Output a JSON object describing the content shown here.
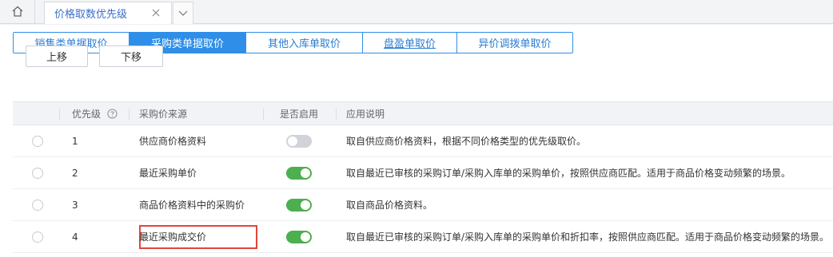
{
  "window": {
    "tab_title": "价格取数优先级",
    "icons": {
      "home": "home-icon",
      "close": "close-icon",
      "more": "chevron-down-icon",
      "help": "help-circle-icon"
    }
  },
  "tabs": [
    {
      "label": "销售类单据取价",
      "active": false
    },
    {
      "label": "采购类单据取价",
      "active": true
    },
    {
      "label": "其他入库单取价",
      "active": false
    },
    {
      "label": "盘盈单取价",
      "active": false
    },
    {
      "label": "异价调拨单取价",
      "active": false
    }
  ],
  "toolbar": {
    "move_up": "上移",
    "move_down": "下移"
  },
  "table": {
    "headers": {
      "priority": "优先级",
      "source": "采购价来源",
      "enabled": "是否启用",
      "description": "应用说明"
    },
    "rows": [
      {
        "priority": "1",
        "source": "供应商价格资料",
        "enabled": false,
        "description": "取自供应商价格资料，根据不同价格类型的优先级取价。"
      },
      {
        "priority": "2",
        "source": "最近采购单价",
        "enabled": true,
        "description": "取自最近已审核的采购订单/采购入库单的采购单价，按照供应商匹配。适用于商品价格变动频繁的场景。"
      },
      {
        "priority": "3",
        "source": "商品价格资料中的采购价",
        "enabled": true,
        "description": "取自商品价格资料。"
      },
      {
        "priority": "4",
        "source": "最近采购成交价",
        "enabled": true,
        "description": "取自最近已审核的采购订单/采购入库单的采购单价和折扣率，按照供应商匹配。适用于商品价格变动频繁的场景。"
      }
    ]
  },
  "colors": {
    "accent": "#2e8ee8",
    "toggle_on": "#4caf50",
    "toggle_off": "#d0d3d8",
    "highlight": "#e0463b"
  }
}
